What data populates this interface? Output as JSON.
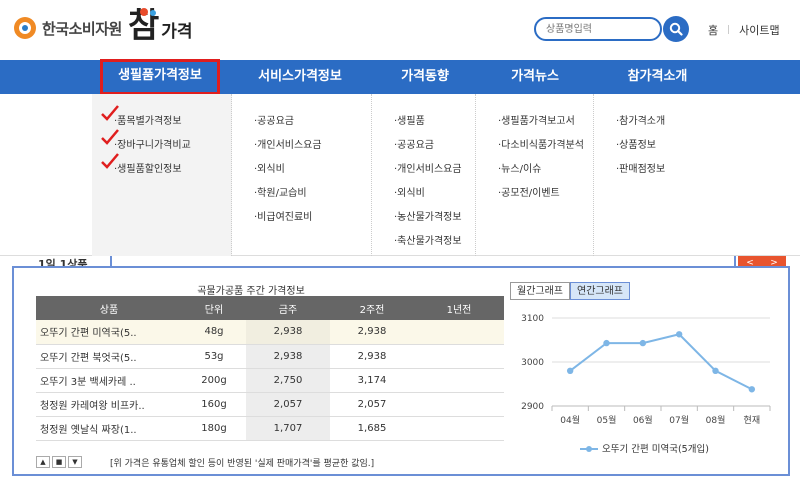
{
  "header": {
    "org_name": "한국소비자원",
    "brand_big": "참",
    "brand_small": "가격",
    "search_placeholder": "상품명입력",
    "util_links": [
      "홈",
      "사이트맵"
    ]
  },
  "nav": {
    "items": [
      "생필품가격정보",
      "서비스가격정보",
      "가격동향",
      "가격뉴스",
      "참가격소개"
    ]
  },
  "dropdown": {
    "col1": [
      "·품목별가격정보",
      "·장바구니가격비교",
      "·생필품할인정보"
    ],
    "col2": [
      "·공공요금",
      "·개인서비스요금",
      "·외식비",
      "·학원/교습비",
      "·비급여진료비"
    ],
    "col3": [
      "·생필품",
      "·공공요금",
      "·개인서비스요금",
      "·외식비",
      "·농산물가격정보",
      "·축산물가격정보"
    ],
    "col4": [
      "·생필품가격보고서",
      "·다소비식품가격분석",
      "·뉴스/이슈",
      "·공모전/이벤트"
    ],
    "col5": [
      "·참가격소개",
      "·상품정보",
      "·판매점정보"
    ]
  },
  "strip": {
    "label": "1일 1상품",
    "prev": "<",
    "next": ">"
  },
  "table": {
    "caption": "곡물가공품 주간 가격정보",
    "headers": [
      "상품",
      "단위",
      "금주",
      "2주전",
      "1년전"
    ],
    "rows": [
      [
        "오뚜기 간편 미역국(5..",
        "48g",
        "2,938",
        "2,938",
        ""
      ],
      [
        "오뚜기 간편 북엇국(5..",
        "53g",
        "2,938",
        "2,938",
        ""
      ],
      [
        "오뚜기 3분 백세카레 ..",
        "200g",
        "2,750",
        "3,174",
        ""
      ],
      [
        "청정원 카레여왕 비프카..",
        "160g",
        "2,057",
        "2,057",
        ""
      ],
      [
        "청정원 옛날식 짜장(1..",
        "180g",
        "1,707",
        "1,685",
        ""
      ]
    ],
    "pager": [
      "▲",
      "■",
      "▼"
    ],
    "note": "[위 가격은 유통업체 할인 등이 반영된 '실제 판매가격'를 평균한 값임.]"
  },
  "chart_tabs": [
    "월간그래프",
    "연간그래프"
  ],
  "chart_data": {
    "type": "line",
    "categories": [
      "04월",
      "05월",
      "06월",
      "07월",
      "08월",
      "현재"
    ],
    "series": [
      {
        "name": "오뚜기 간편 미역국(5개입)",
        "values": [
          2980,
          3043,
          3043,
          3063,
          2980,
          2938
        ]
      }
    ],
    "yticks": [
      2900,
      3000,
      3100
    ],
    "ylim": [
      2900,
      3100
    ],
    "legend": "bottom",
    "color": "#7eb6e6"
  },
  "colors": {
    "primary": "#2b6cc4",
    "highlight": "#e01e1e",
    "accent": "#e8542e"
  }
}
